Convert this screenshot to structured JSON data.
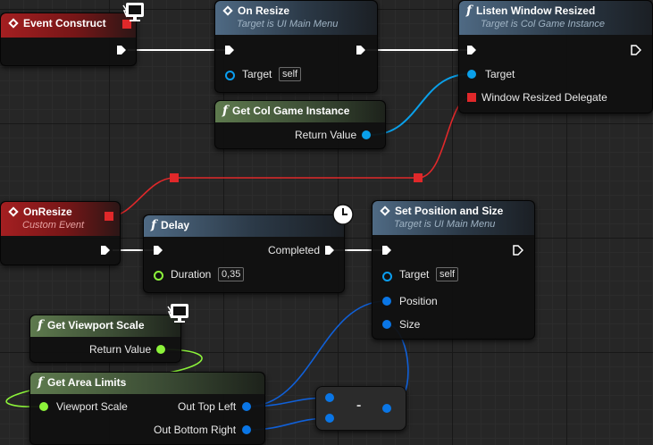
{
  "colors": {
    "exec_wire": "#ffffff",
    "object_wire": "#0aa0ea",
    "struct_wire": "#1060d8",
    "float_wire": "#8cf33a",
    "delegate_wire": "#e0282a",
    "header_function": "#4f6a84",
    "header_pure": "#5e7a4e",
    "header_event": "#a41f21"
  },
  "nodes": {
    "event_construct": {
      "title": "Event Construct",
      "icon": "event-diamond-icon",
      "badge_icon": "client-only-monitor-icon"
    },
    "on_resize_call": {
      "title": "On Resize",
      "subtitle": "Target is UI Main Menu",
      "icon": "function-call-diamond-icon",
      "target_label": "Target",
      "target_value": "self"
    },
    "listen_window_resized": {
      "title": "Listen Window Resized",
      "subtitle": "Target is Col Game Instance",
      "icon": "function-f-icon",
      "target_label": "Target",
      "delegate_label": "Window Resized Delegate"
    },
    "get_col_game_instance": {
      "title": "Get Col Game Instance",
      "icon": "function-f-icon",
      "output_label": "Return Value"
    },
    "on_resize_event": {
      "title": "OnResize",
      "subtitle": "Custom Event",
      "icon": "event-diamond-icon"
    },
    "delay": {
      "title": "Delay",
      "icon": "function-f-icon",
      "badge_icon": "latent-clock-icon",
      "output_label": "Completed",
      "duration_label": "Duration",
      "duration_value": "0,35"
    },
    "set_position_and_size": {
      "title": "Set Position and Size",
      "subtitle": "Target is UI Main Menu",
      "icon": "function-call-diamond-icon",
      "target_label": "Target",
      "target_value": "self",
      "position_label": "Position",
      "size_label": "Size"
    },
    "get_viewport_scale": {
      "title": "Get Viewport Scale",
      "icon": "function-f-icon",
      "badge_icon": "client-only-monitor-icon",
      "output_label": "Return Value"
    },
    "get_area_limits": {
      "title": "Get Area Limits",
      "icon": "function-f-icon",
      "input_label": "Viewport Scale",
      "output_top_left": "Out Top Left",
      "output_bottom_right": "Out Bottom Right"
    },
    "subtract": {
      "symbol": "-"
    }
  }
}
